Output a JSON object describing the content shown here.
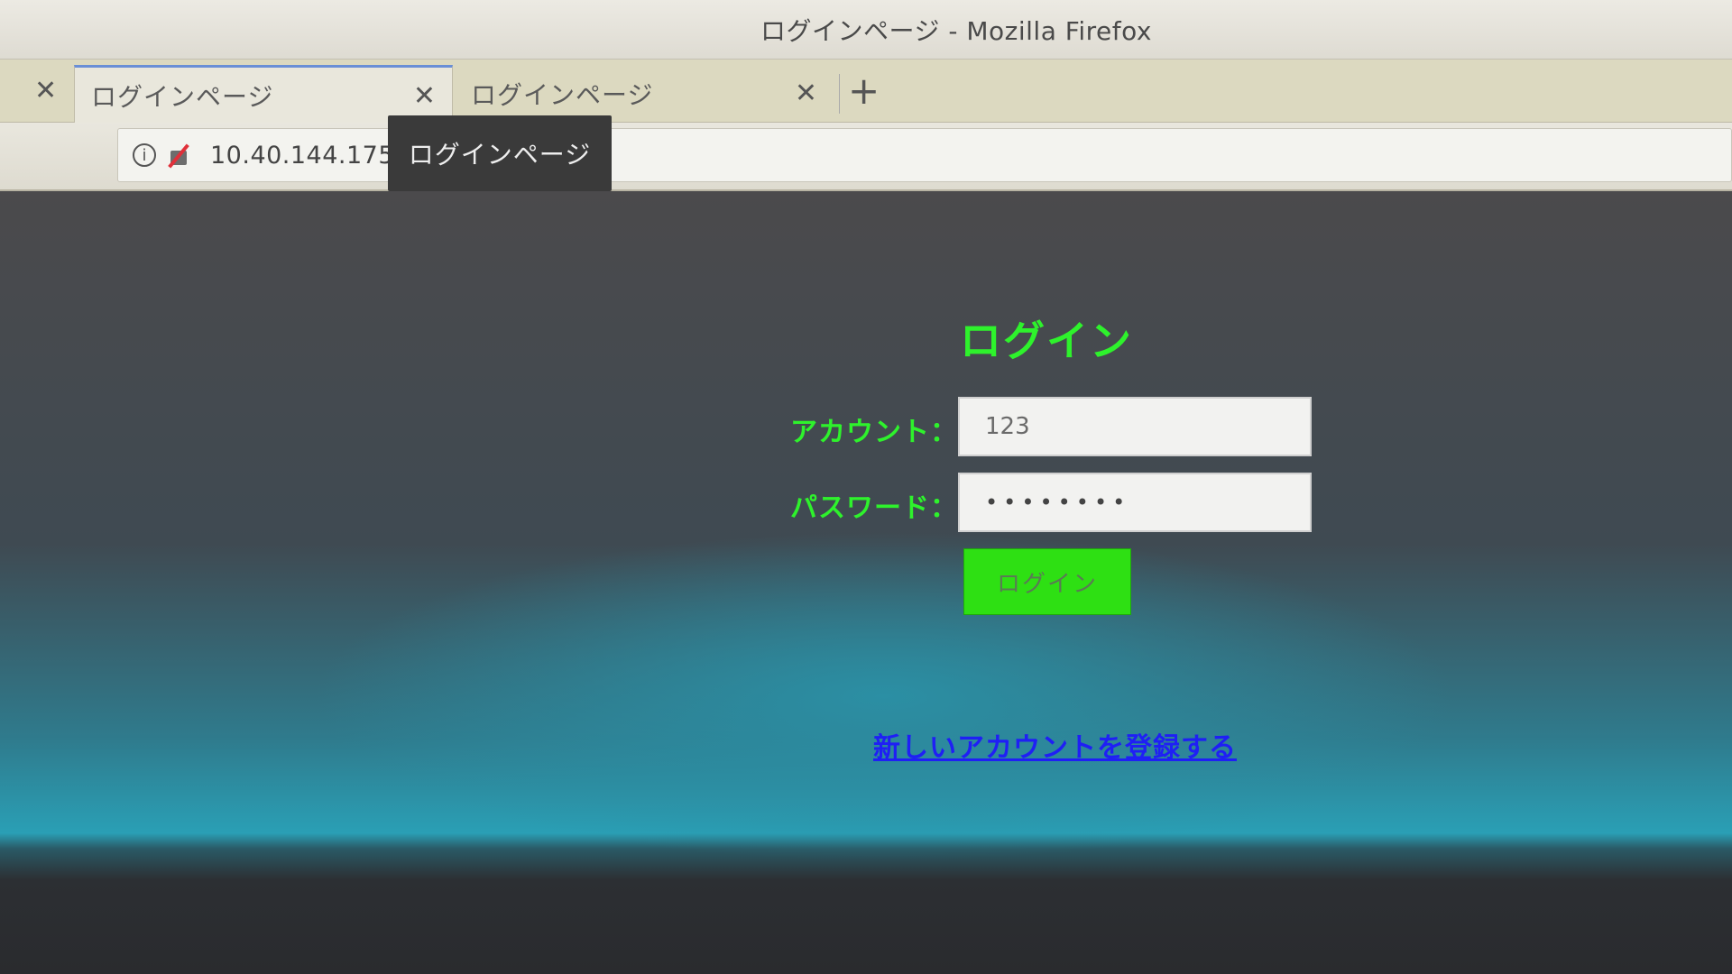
{
  "window": {
    "title": "ログインページ - Mozilla Firefox"
  },
  "tabs": [
    {
      "label": "ログインページ",
      "active": true
    },
    {
      "label": "ログインページ",
      "active": false
    }
  ],
  "icons": {
    "left_close": "close-icon",
    "tab_close": "close-icon",
    "new_tab": "plus-icon",
    "info": "info-icon",
    "insecure": "insecure-lock-icon"
  },
  "glyphs": {
    "close": "✕",
    "plus": "+",
    "info": "i"
  },
  "addressbar": {
    "url": "10.40.144.175"
  },
  "tooltip": {
    "text": "ログインページ"
  },
  "login": {
    "title": "ログイン",
    "account_label": "アカウント：",
    "account_value": "123",
    "password_label": "パスワード：",
    "password_value": "••••••••",
    "submit_label": "ログイン",
    "register_link": "新しいアカウントを登録する"
  },
  "colors": {
    "accent_green": "#2ef22c",
    "button_green": "#2ee013",
    "link_blue": "#1f1ff5"
  }
}
